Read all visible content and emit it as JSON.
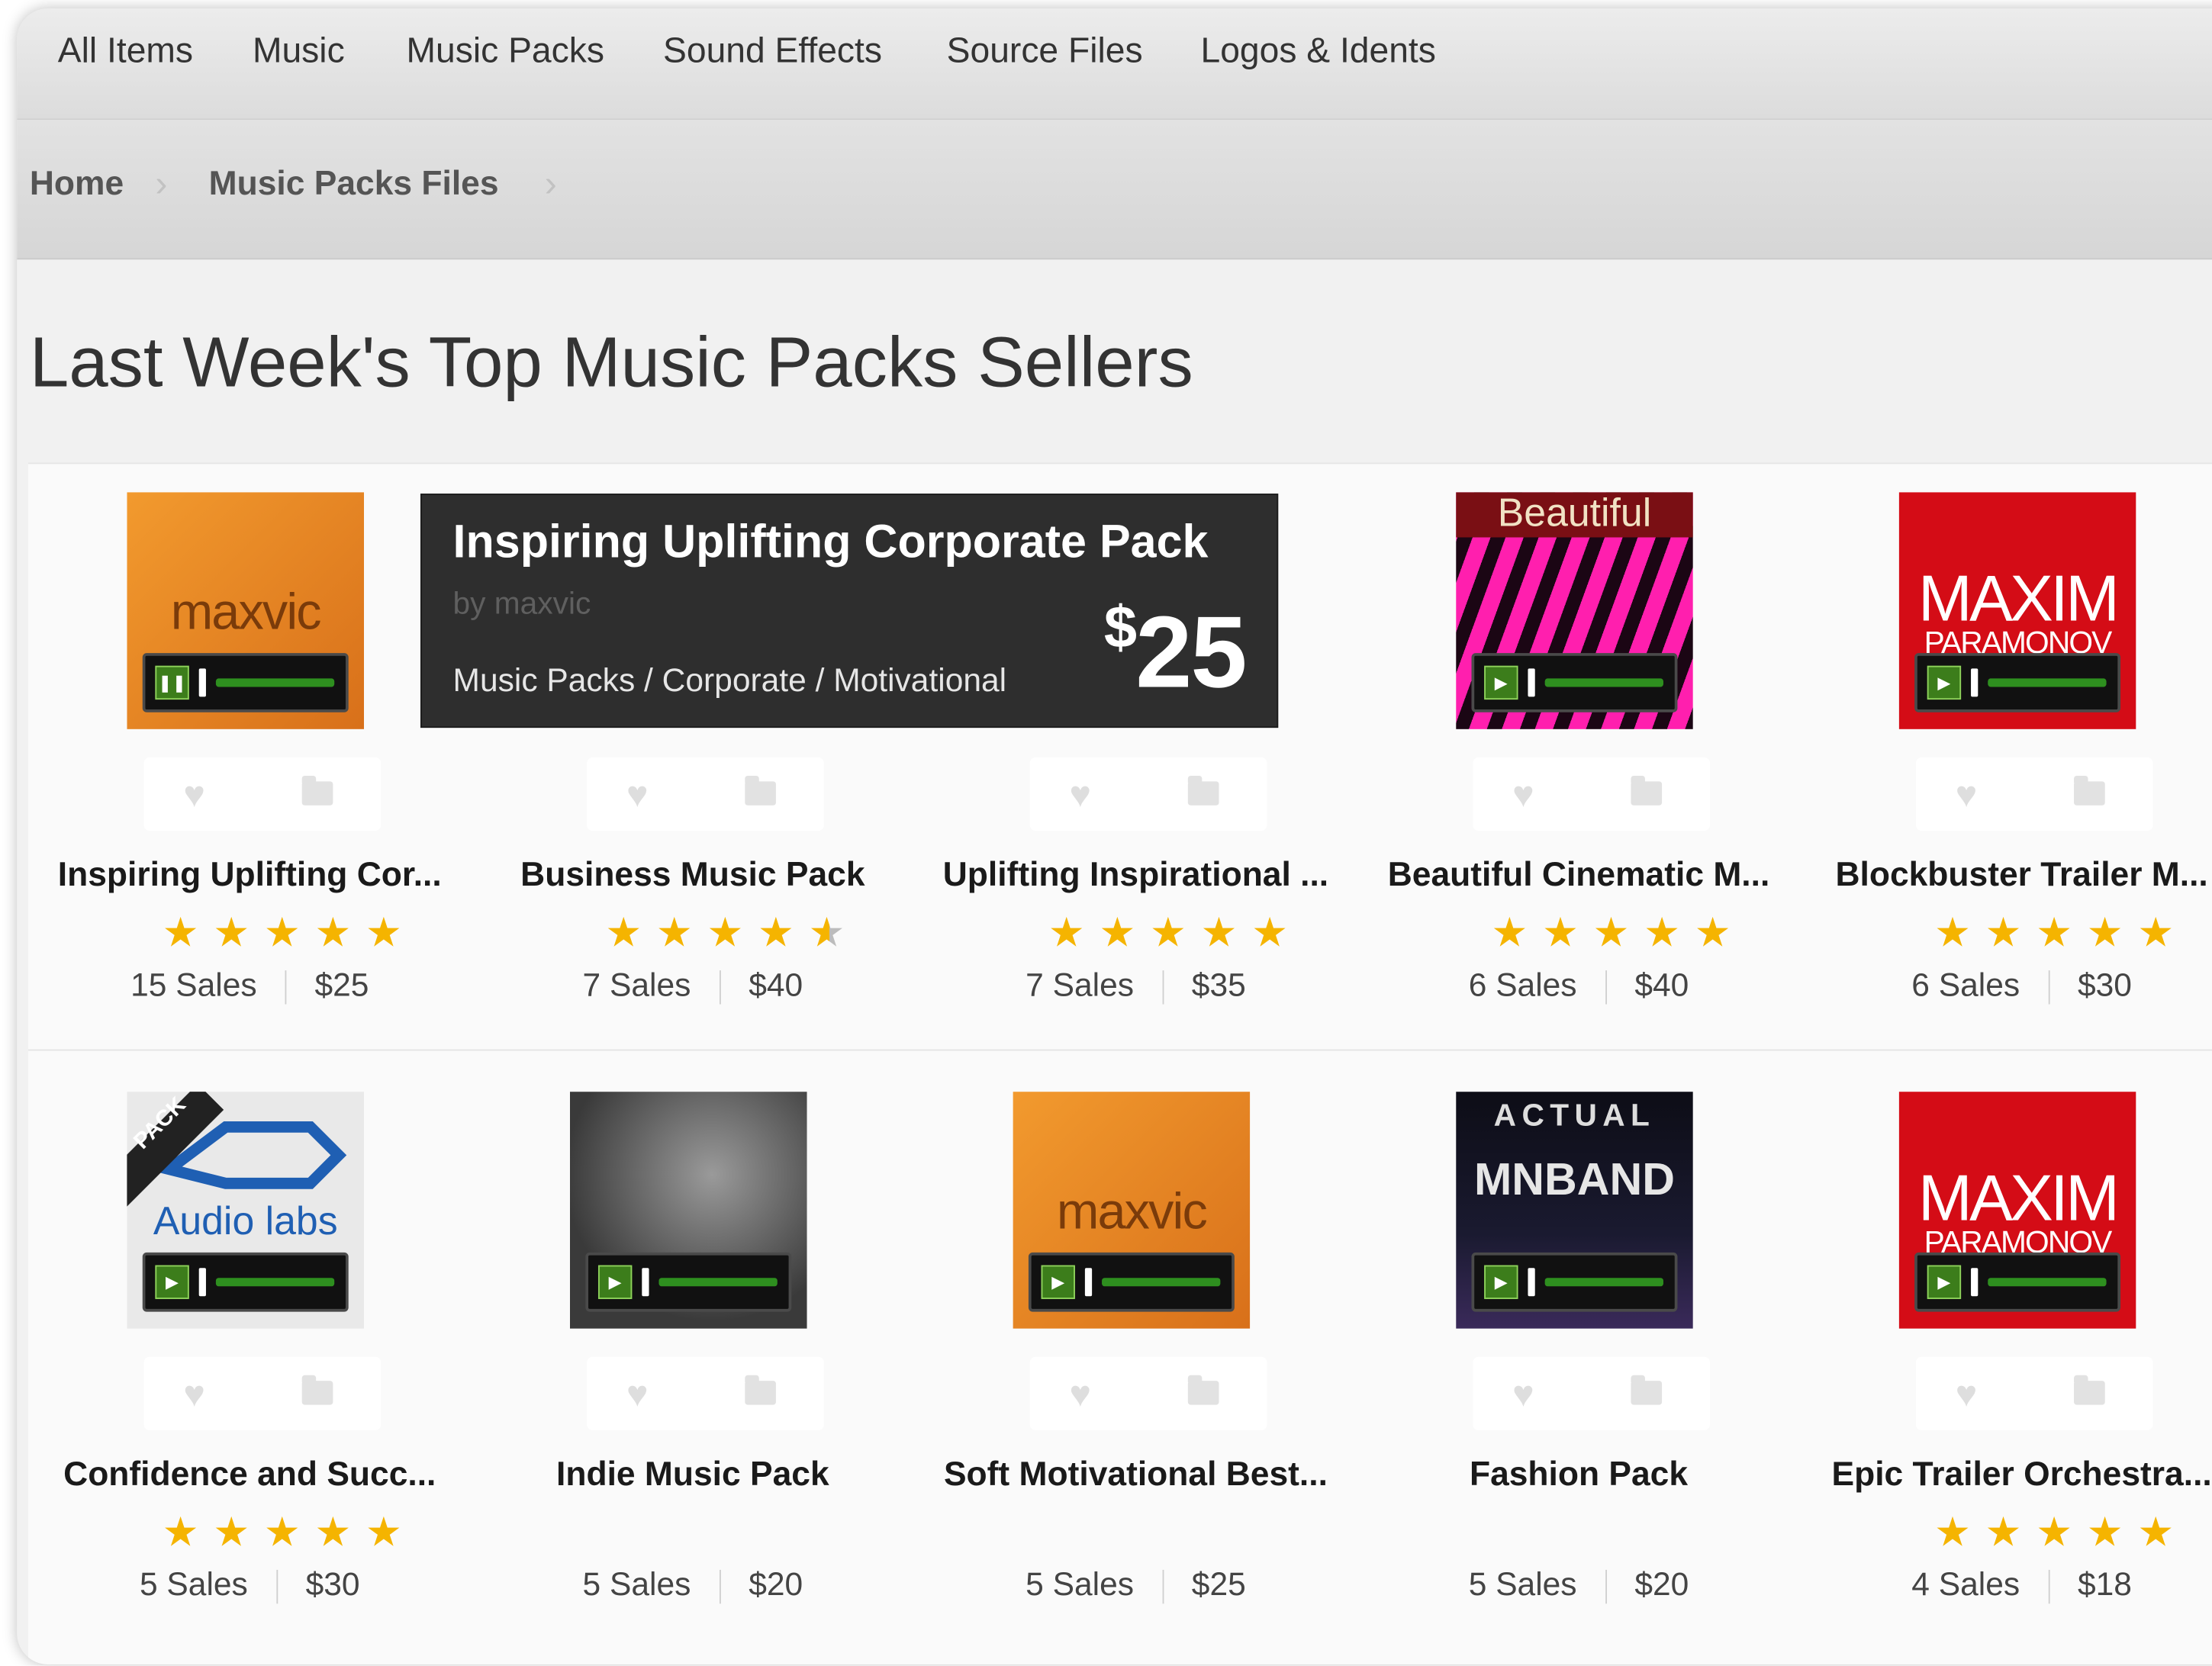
{
  "topnav": {
    "items": [
      "All Items",
      "Music",
      "Music Packs",
      "Sound Effects",
      "Source Files",
      "Logos & Idents"
    ]
  },
  "breadcrumb": {
    "home": "Home",
    "section": "Music Packs Files",
    "separator": "›"
  },
  "page_title": "Last Week's Top Music Packs Sellers",
  "tooltip": {
    "title": "Inspiring Uplifting Corporate Pack",
    "author": "by maxvic",
    "category": "Music Packs / Corporate / Motivational",
    "price_symbol": "$",
    "price_value": "25"
  },
  "thumb_text": {
    "maxvic": "maxvic",
    "beautiful": "Beautiful",
    "maxim_1": "MAXIM",
    "maxim_2": "PARAMONOV",
    "pack_ribbon": "PACK",
    "audiolabs": "Audio labs",
    "actual": "ACTUAL",
    "mnband": "MNBAND"
  },
  "items": [
    {
      "title": "Inspiring Uplifting Cor...",
      "sales": "15 Sales",
      "price": "$25",
      "rating": 5,
      "thumb": "maxvic",
      "playing": true
    },
    {
      "title": "Business Music Pack",
      "sales": "7 Sales",
      "price": "$40",
      "rating": 4.5,
      "thumb": "none",
      "playing": false
    },
    {
      "title": "Uplifting Inspirational ...",
      "sales": "7 Sales",
      "price": "$35",
      "rating": 5,
      "thumb": "none",
      "playing": false
    },
    {
      "title": "Beautiful Cinematic M...",
      "sales": "6 Sales",
      "price": "$40",
      "rating": 5,
      "thumb": "beautiful",
      "playing": false
    },
    {
      "title": "Blockbuster Trailer M...",
      "sales": "6 Sales",
      "price": "$30",
      "rating": 5,
      "thumb": "maxim",
      "playing": false
    },
    {
      "title": "Confidence and Succ...",
      "sales": "5 Sales",
      "price": "$30",
      "rating": 5,
      "thumb": "audiolabs",
      "playing": false
    },
    {
      "title": "Indie Music Pack",
      "sales": "5 Sales",
      "price": "$20",
      "rating": 0,
      "thumb": "indie",
      "playing": false
    },
    {
      "title": "Soft Motivational Best...",
      "sales": "5 Sales",
      "price": "$25",
      "rating": 0,
      "thumb": "maxvic",
      "playing": false
    },
    {
      "title": "Fashion Pack",
      "sales": "5 Sales",
      "price": "$20",
      "rating": 0,
      "thumb": "actual",
      "playing": false
    },
    {
      "title": "Epic Trailer Orchestra...",
      "sales": "4 Sales",
      "price": "$18",
      "rating": 5,
      "thumb": "maxim",
      "playing": false
    }
  ],
  "icons": {
    "heart": "heart-icon",
    "folder": "folder-icon",
    "play": "play-icon",
    "pause": "pause-icon",
    "star": "star-icon",
    "chevron": "chevron-right-icon"
  },
  "colors": {
    "accent_orange": "#e5821d",
    "maxim_red": "#d40c16",
    "star": "#f5b400",
    "player_green": "#2e8f1f"
  }
}
